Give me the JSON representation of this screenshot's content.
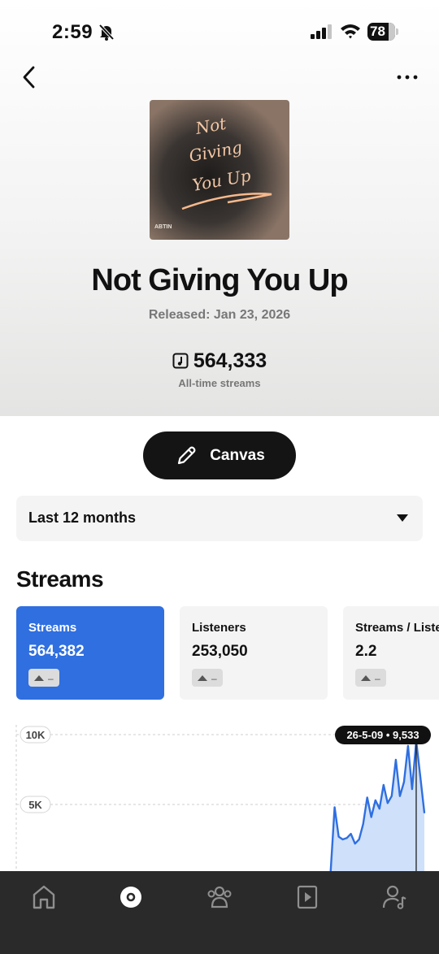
{
  "status": {
    "time": "2:59",
    "battery": "78"
  },
  "track": {
    "cover_title_lines": [
      "Not",
      "Giving",
      "You Up"
    ],
    "cover_artist": "ABTIN",
    "title": "Not Giving You Up",
    "released": "Released: Jan 23, 2026",
    "total_streams": "564,333",
    "total_streams_label": "All-time streams"
  },
  "canvas_button": {
    "label": "Canvas"
  },
  "range_select": {
    "label": "Last 12 months"
  },
  "section": {
    "title": "Streams"
  },
  "metrics": [
    {
      "label": "Streams",
      "value": "564,382",
      "trend": "–"
    },
    {
      "label": "Listeners",
      "value": "253,050",
      "trend": "–"
    },
    {
      "label": "Streams / Listener",
      "value": "2.2",
      "trend": "–"
    }
  ],
  "chart_data": {
    "type": "area",
    "ytick_labels": [
      "10K",
      "5K"
    ],
    "ylim": [
      0,
      10000
    ],
    "tooltip": "26-5-09 • 9,533",
    "highlight": {
      "x": "26-5-09",
      "y": 9533
    },
    "x_start": 0,
    "x_end": 100,
    "series": [
      {
        "color": "#2f6fe0",
        "x": [
          0,
          77,
          78,
          79,
          80,
          81,
          82,
          83,
          84,
          85,
          86,
          87,
          88,
          89,
          90,
          91,
          92,
          93,
          94,
          95,
          96,
          97,
          98,
          99,
          100
        ],
        "y": [
          0,
          0,
          4800,
          2700,
          2500,
          2600,
          2900,
          2200,
          2500,
          3600,
          5500,
          4100,
          5300,
          4700,
          6400,
          5100,
          5600,
          8200,
          5600,
          6600,
          9200,
          6100,
          9533,
          7000,
          4400
        ]
      }
    ]
  },
  "tab_bar": {
    "icons": [
      "home-icon",
      "catalog-icon",
      "audience-icon",
      "campaigns-icon",
      "profile-icon"
    ],
    "active_index": 1
  },
  "colors": {
    "accent": "#2f6fe0",
    "dark": "#141414",
    "tab_bar": "#2a2a2a"
  }
}
